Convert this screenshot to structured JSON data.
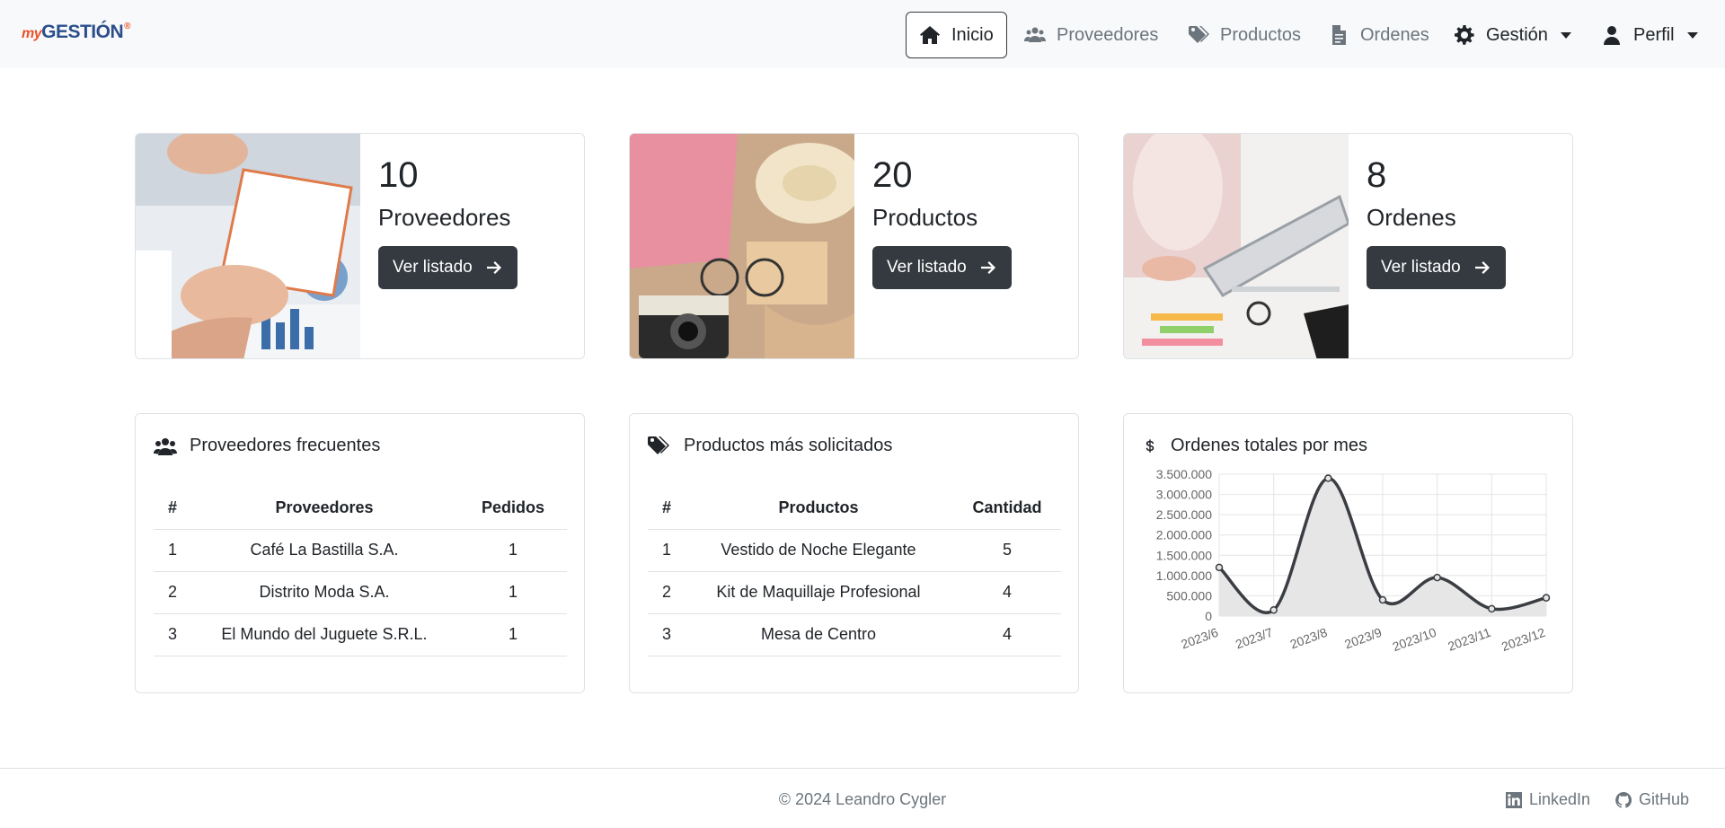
{
  "brand": {
    "prefix": "my",
    "name": "GESTIÓN",
    "mark": "®"
  },
  "nav": {
    "inicio": "Inicio",
    "proveedores": "Proveedores",
    "productos": "Productos",
    "ordenes": "Ordenes",
    "gestion": "Gestión",
    "perfil": "Perfil"
  },
  "stats": [
    {
      "count": "10",
      "label": "Proveedores",
      "button": "Ver listado"
    },
    {
      "count": "20",
      "label": "Productos",
      "button": "Ver listado"
    },
    {
      "count": "8",
      "label": "Ordenes",
      "button": "Ver listado"
    }
  ],
  "proveedores_card": {
    "title": "Proveedores frecuentes",
    "headers": [
      "#",
      "Proveedores",
      "Pedidos"
    ],
    "rows": [
      [
        "1",
        "Café La Bastilla S.A.",
        "1"
      ],
      [
        "2",
        "Distrito Moda S.A.",
        "1"
      ],
      [
        "3",
        "El Mundo del Juguete S.R.L.",
        "1"
      ]
    ]
  },
  "productos_card": {
    "title": "Productos más solicitados",
    "headers": [
      "#",
      "Productos",
      "Cantidad"
    ],
    "rows": [
      [
        "1",
        "Vestido de Noche Elegante",
        "5"
      ],
      [
        "2",
        "Kit de Maquillaje Profesional",
        "4"
      ],
      [
        "3",
        "Mesa de Centro",
        "4"
      ]
    ]
  },
  "ordenes_card": {
    "title": "Ordenes totales por mes"
  },
  "chart_data": {
    "type": "area",
    "title": "Ordenes totales por mes",
    "categories": [
      "2023/6",
      "2023/7",
      "2023/8",
      "2023/9",
      "2023/10",
      "2023/11",
      "2023/12"
    ],
    "series": [
      {
        "values": [
          1200000,
          150000,
          3400000,
          400000,
          950000,
          180000,
          450000
        ]
      }
    ],
    "ylim": [
      0,
      3500000
    ],
    "yticks": [
      "0",
      "500.000",
      "1.000.000",
      "1.500.000",
      "2.000.000",
      "2.500.000",
      "3.000.000",
      "3.500.000"
    ],
    "grid": true,
    "line_color": "#3a3d42",
    "fill_color": "#e6e6e6"
  },
  "footer": {
    "copyright": "© 2024 Leandro Cygler",
    "linkedin": "LinkedIn",
    "github": "GitHub"
  },
  "icons": {
    "home": "home-icon",
    "users": "users-icon",
    "tags": "tags-icon",
    "file": "file-icon",
    "gear": "gear-icon",
    "user": "user-icon",
    "arrow": "arrow-right-icon",
    "dollar": "dollar-icon"
  }
}
